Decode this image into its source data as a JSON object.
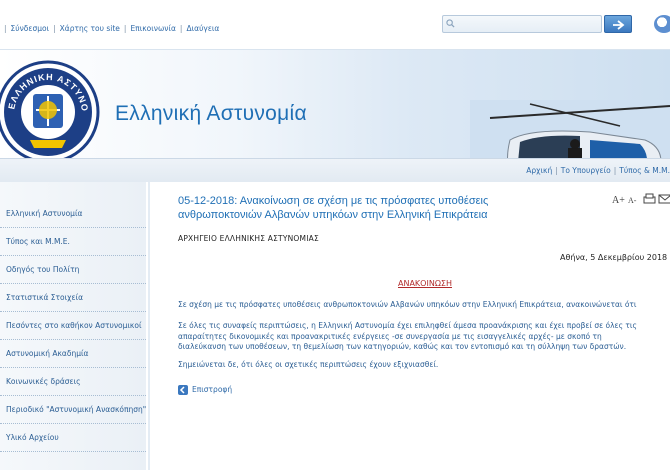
{
  "top_links": [
    "Σύνδεσμοι",
    "Χάρτης του site",
    "Επικοινωνία",
    "Διαύγεια"
  ],
  "search": {
    "placeholder": ""
  },
  "banner": {
    "title": "Ελληνική Αστυνομία",
    "logo_text": "ΕΛΛΗΝΙΚΗ ΑΣΤΥΝΟΜΙΑ"
  },
  "breadcrumb_links": [
    "Αρχική",
    "Το Υπουργείο",
    "Τύπος & Μ.Μ."
  ],
  "sidebar": {
    "items": [
      "Ελληνική Αστυνομία",
      "Τύπος και Μ.Μ.Ε.",
      "Οδηγός του Πολίτη",
      "Στατιστικά Στοιχεία",
      "Πεσόντες στο καθήκον Αστυνομικοί",
      "Αστυνομική Ακαδημία",
      "Κοινωνικές δράσεις",
      "Περιοδικό \"Αστυνομική Ανασκόπηση\"",
      "Υλικό Αρχείου"
    ]
  },
  "article": {
    "title_line1": "05-12-2018: Ανακοίνωση σε σχέση με τις πρόσφατες υποθέσεις",
    "title_line2": "ανθρωποκτονιών Αλβανών υπηκόων στην Ελληνική Επικράτεια",
    "org": "ΑΡΧΗΓΕΙΟ ΕΛΛΗΝΙΚΗΣ ΑΣΤΥΝΟΜΙΑΣ",
    "date": "Αθήνα, 5 Δεκεμβρίου 2018",
    "heading": "ΑΝΑΚΟΙΝΩΣΗ",
    "para1": "Σε σχέση με τις πρόσφατες υποθέσεις ανθρωποκτονιών Αλβανών υπηκόων στην Ελληνική Επικράτεια, ανακοινώνεται ότι",
    "para2_line1": "Σε όλες τις συναφείς περιπτώσεις, η Ελληνική Αστυνομία έχει επιληφθεί άμεσα προανάκρισης και έχει προβεί σε όλες τις",
    "para2_line2": "απαραίτητες δικονομικές και προανακριτικές ενέργειες -σε συνεργασία με τις εισαγγελικές αρχές- με σκοπό τη",
    "para2_line3": "διαλεύκανση των υποθέσεων, τη θεμελίωση των κατηγοριών, καθώς και τον εντοπισμό και τη σύλληψη των δραστών.",
    "para3": "Σημειώνεται δε, ότι όλες οι σχετικές περιπτώσεις έχουν εξιχνιασθεί.",
    "back_label": "Επιστροφή"
  },
  "tools": {
    "font_increase": "A+",
    "font_decrease": "A-"
  },
  "colors": {
    "link_blue": "#2f6aa8",
    "title_blue": "#1f6fb5",
    "heading_red": "#b12a2a"
  }
}
